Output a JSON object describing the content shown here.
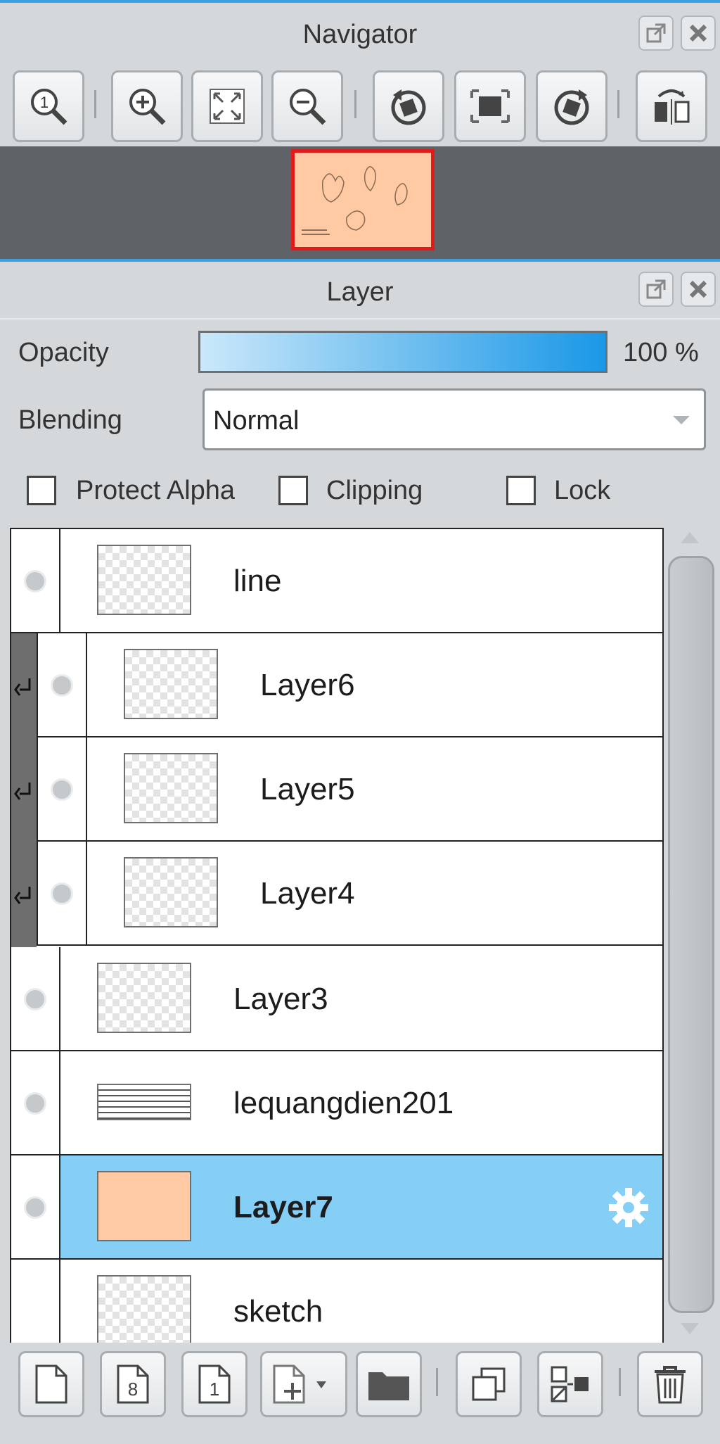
{
  "navigator": {
    "title": "Navigator",
    "tools": [
      {
        "icon": "actual-size-icon"
      },
      {
        "icon": "zoom-in-icon"
      },
      {
        "icon": "fit-window-icon"
      },
      {
        "icon": "zoom-out-icon"
      },
      {
        "icon": "rotate-left-icon"
      },
      {
        "icon": "reset-rotation-icon"
      },
      {
        "icon": "rotate-right-icon"
      },
      {
        "icon": "flip-horizontal-icon"
      }
    ]
  },
  "layer_panel": {
    "title": "Layer",
    "opacity_label": "Opacity",
    "opacity_value": "100 %",
    "opacity_fraction": 1.0,
    "blending_label": "Blending",
    "blending_value": "Normal",
    "checkboxes": {
      "protect_alpha": "Protect Alpha",
      "clipping": "Clipping",
      "lock": "Lock"
    },
    "layers": [
      {
        "name": "line",
        "clipped": false
      },
      {
        "name": "Layer6",
        "clipped": true
      },
      {
        "name": "Layer5",
        "clipped": true
      },
      {
        "name": "Layer4",
        "clipped": true
      },
      {
        "name": "Layer3",
        "clipped": false
      },
      {
        "name": "lequangdien201",
        "clipped": false
      },
      {
        "name": "Layer7",
        "clipped": false,
        "selected": true
      },
      {
        "name": "sketch",
        "clipped": false
      }
    ],
    "bottom_tools": [
      {
        "icon": "new-layer-icon"
      },
      {
        "icon": "new-8bit-layer-icon"
      },
      {
        "icon": "new-1bit-layer-icon"
      },
      {
        "icon": "add-layer-menu-icon"
      },
      {
        "icon": "folder-icon"
      },
      {
        "icon": "duplicate-layer-icon"
      },
      {
        "icon": "merge-down-icon"
      },
      {
        "icon": "delete-layer-icon"
      }
    ]
  },
  "colors": {
    "accent": "#2aa0e8",
    "selected_row": "#85cff7",
    "canvas_fill": "#ffc9a4",
    "nav_frame": "#e11a1a"
  }
}
